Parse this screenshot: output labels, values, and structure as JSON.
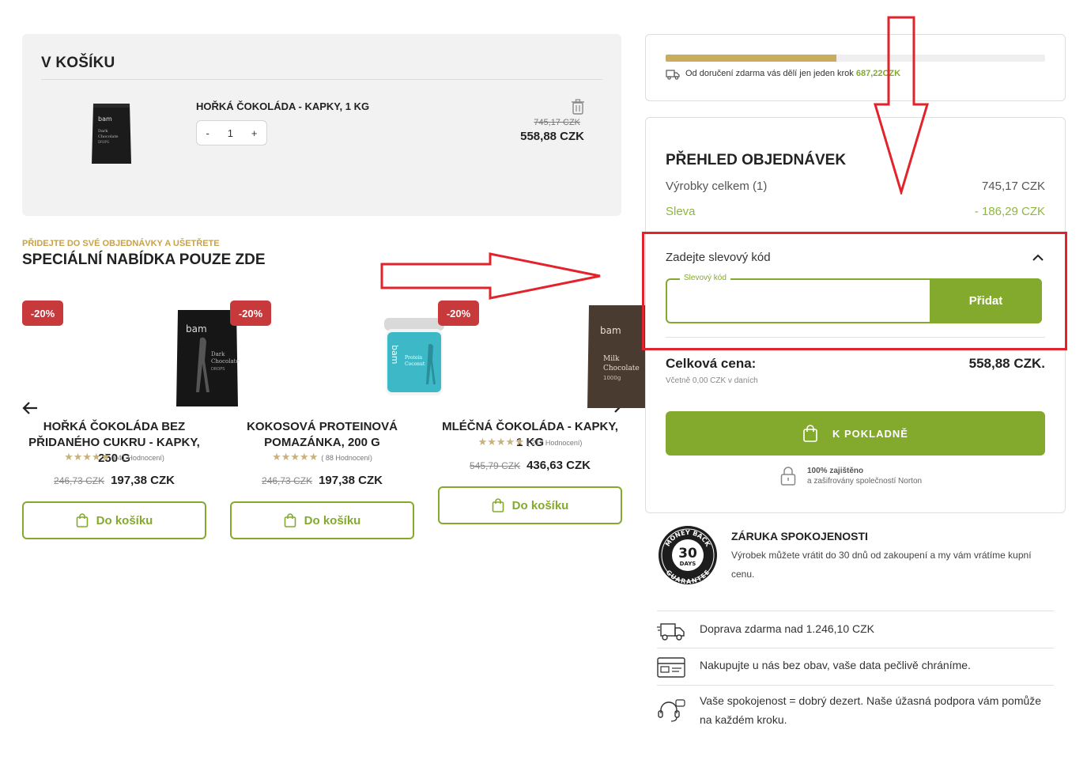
{
  "cart": {
    "title": "V KOŠÍKU",
    "item": {
      "name": "HOŘKÁ ČOKOLÁDA - KAPKY, 1 KG",
      "qty_minus": "-",
      "qty_value": "1",
      "qty_plus": "+",
      "old_price": "745,17 CZK",
      "price": "558,88 CZK"
    }
  },
  "offer": {
    "kicker": "PŘIDEJTE DO SVÉ OBJEDNÁVKY A UŠETŘETE",
    "title": "SPECIÁLNÍ NABÍDKA POUZE ZDE",
    "products": [
      {
        "badge": "-20%",
        "name": "HOŘKÁ ČOKOLÁDA BEZ PŘIDANÉHO CUKRU - KAPKY, 250 G",
        "stars": "★★★★★",
        "reviews": "( 41 Hodnocení)",
        "old_price": "246,73 CZK",
        "price": "197,38 CZK",
        "button": "Do košíku"
      },
      {
        "badge": "-20%",
        "name": "KOKOSOVÁ PROTEINOVÁ POMAZÁNKA, 200 G",
        "stars": "★★★★★",
        "reviews": "( 88 Hodnocení)",
        "old_price": "246,73 CZK",
        "price": "197,38 CZK",
        "button": "Do košíku"
      },
      {
        "badge": "-20%",
        "name": "MLÉČNÁ ČOKOLÁDA - KAPKY, 1 KG",
        "stars": "★★★★★",
        "reviews": "( 217 Hodnocení)",
        "old_price": "545,79 CZK",
        "price": "436,63 CZK",
        "button": "Do košíku"
      }
    ]
  },
  "shipping": {
    "progress_fraction": 0.45,
    "text": "Od doručení zdarma vás dělí jen jeden krok",
    "amount": "687,22CZK"
  },
  "summary": {
    "title": "PŘEHLED OBJEDNÁVEK",
    "products_label": "Výrobky celkem (1)",
    "products_value": "745,17 CZK",
    "discount_label": "Sleva",
    "discount_value": "- 186,29 CZK",
    "coupon_label": "Zadejte slevový kód",
    "coupon_field_label": "Slevový kód",
    "coupon_value": "",
    "coupon_button": "Přidat",
    "total_label": "Celková cena:",
    "total_value": "558,88 CZK.",
    "tax_note": "Včetně 0,00 CZK v daních",
    "checkout_button": "K POKLADNĚ",
    "secure_title": "100% zajištěno",
    "secure_sub": "a zašifrovány společností Norton"
  },
  "guarantee": {
    "badge_top": "MONEY BACK",
    "badge_number": "30",
    "badge_days": "DAYS",
    "badge_bottom": "GUARANTEE",
    "title": "ZÁRUKA SPOKOJENOSTI",
    "text": "Výrobek můžete vrátit do 30 dnů od zakoupení a my vám vrátíme kupní cenu."
  },
  "features": [
    {
      "icon": "truck-icon",
      "text": "Doprava zdarma nad 1.246,10 CZK"
    },
    {
      "icon": "credit-card-icon",
      "text": "Nakupujte u nás bez obav, vaše data pečlivě chráníme."
    },
    {
      "icon": "headset-icon",
      "text": "Vaše spokojenost = dobrý dezert. Naše úžasná podpora vám pomůže na každém kroku."
    }
  ],
  "colors": {
    "accent_green": "#84aa2d",
    "gold": "#c9ac5e",
    "badge_red": "#c8393c",
    "annotation_red": "#e3232b"
  }
}
